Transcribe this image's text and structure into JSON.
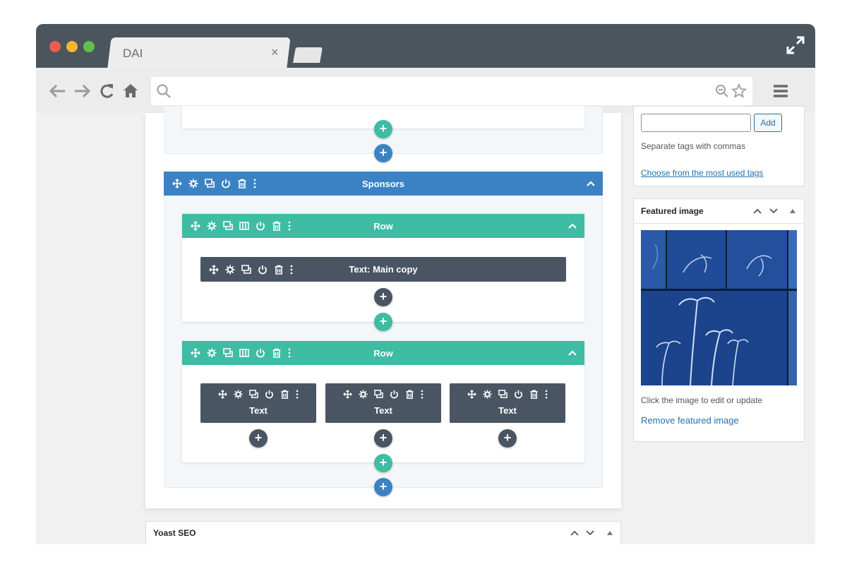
{
  "browser": {
    "tab_title": "DAI",
    "tab_close": "×",
    "colors": {
      "close": "#ee5b4f",
      "minimize": "#f5b52e",
      "maximize": "#5fbf4f",
      "chrome": "#4a555e"
    },
    "toolbar_icons": [
      "back-arrow-icon",
      "forward-arrow-icon",
      "reload-icon",
      "home-icon",
      "search-icon",
      "zoom-icon",
      "star-icon",
      "menu-icon"
    ],
    "url": ""
  },
  "builder": {
    "section_title": "Sponsors",
    "rows": [
      {
        "title": "Row",
        "modules": [
          {
            "label": "Text: Main copy"
          }
        ]
      },
      {
        "title": "Row",
        "modules": [
          {
            "label": "Text"
          },
          {
            "label": "Text"
          },
          {
            "label": "Text"
          }
        ]
      }
    ],
    "add_symbol": "+",
    "colors": {
      "section": "#3b82c4",
      "row": "#3ebca4",
      "module": "#4a5563"
    }
  },
  "sidebar": {
    "tags": {
      "add_label": "Add",
      "hint": "Separate tags with commas",
      "choose_link": "Choose from the most used tags"
    },
    "featured": {
      "title": "Featured image",
      "edit_hint": "Click the image to edit or update",
      "remove_link": "Remove featured image"
    }
  },
  "yoast": {
    "title": "Yoast SEO"
  }
}
